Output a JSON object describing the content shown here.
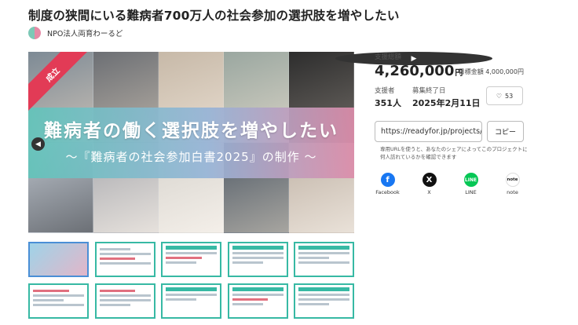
{
  "project": {
    "title": "制度の狭間にいる難病者700万人の社会参加の選択肢を増やしたい",
    "organization": "NPO法人両育わーるど"
  },
  "hero": {
    "status_ribbon": "成立",
    "banner_main": "難病者の働く選択肢を増やしたい",
    "banner_sub": "〜『難病者の社会参加白書2025』の制作 〜",
    "prev_icon": "chevron-left-icon",
    "next_icon": "chevron-right-icon"
  },
  "thumbnails": {
    "count": 10,
    "selected_index": 0
  },
  "funding": {
    "amount_label": "支援総額",
    "amount_value": "4,260,000",
    "currency": "円",
    "goal_text": "目標金額 4,000,000円",
    "supporters_label": "支援者",
    "supporters_value": "351人",
    "end_label": "募集終了日",
    "end_value": "2025年2月11日",
    "likes": "53"
  },
  "share": {
    "url": "https://readyfor.jp/projects/...",
    "copy_label": "コピー",
    "note": "専用URLを使うと、あなたのシェアによってこのプロジェクトに何人訪れているかを確認できます",
    "items": [
      {
        "label": "Facebook",
        "icon": "facebook-icon",
        "glyph": "f",
        "color": "#1877f2"
      },
      {
        "label": "X",
        "icon": "x-icon",
        "glyph": "X",
        "color": "#111111"
      },
      {
        "label": "LINE",
        "icon": "line-icon",
        "glyph": "L",
        "color": "#06c755"
      },
      {
        "label": "note",
        "icon": "note-icon",
        "glyph": "note",
        "color": "#ffffff"
      }
    ]
  },
  "colors": {
    "accent_teal": "#37b9a4",
    "ribbon_red": "#e23b56"
  }
}
